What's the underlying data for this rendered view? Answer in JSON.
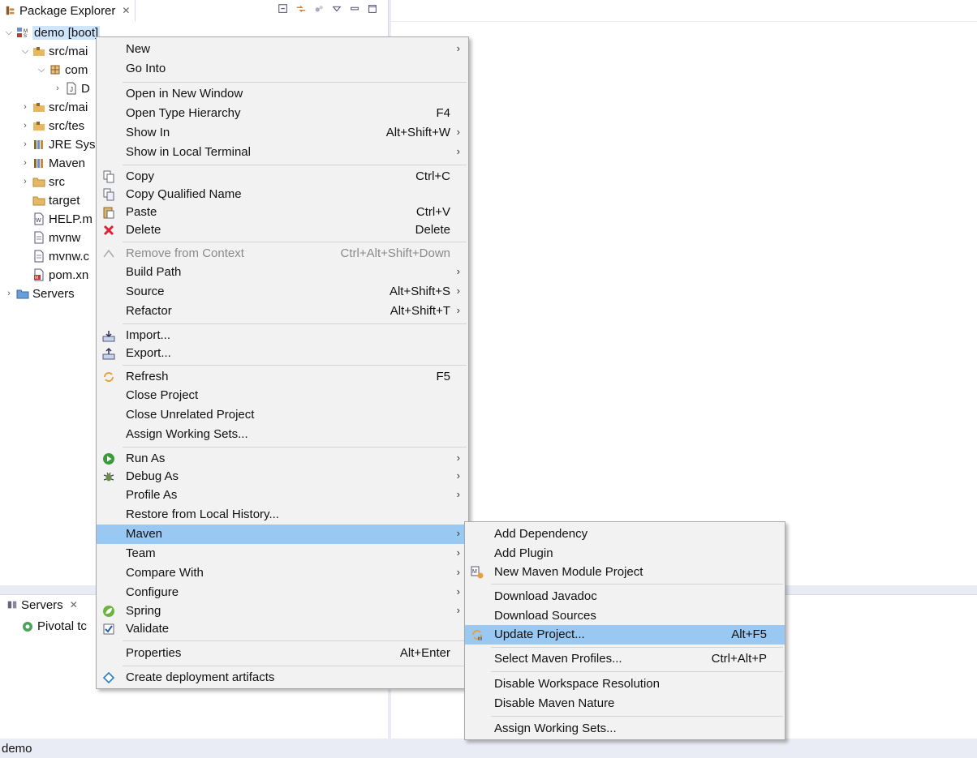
{
  "package_explorer": {
    "tab_title": "Package Explorer",
    "tree": [
      {
        "label": "demo [boot]",
        "icon": "maven-project-icon",
        "twisty": "expanded",
        "selected": true
      },
      {
        "label": "src/mai",
        "icon": "source-folder-icon",
        "twisty": "expanded"
      },
      {
        "label": "com",
        "icon": "package-icon",
        "twisty": "expanded"
      },
      {
        "label": "D",
        "icon": "java-file-icon",
        "twisty": "collapsed"
      },
      {
        "label": "src/mai",
        "icon": "source-folder-icon",
        "twisty": "collapsed"
      },
      {
        "label": "src/tes",
        "icon": "source-folder-icon",
        "twisty": "collapsed"
      },
      {
        "label": "JRE Sys",
        "icon": "library-icon",
        "twisty": "collapsed"
      },
      {
        "label": "Maven",
        "icon": "library-icon",
        "twisty": "collapsed"
      },
      {
        "label": "src",
        "icon": "folder-icon",
        "twisty": "collapsed"
      },
      {
        "label": "target",
        "icon": "folder-icon",
        "twisty": "none"
      },
      {
        "label": "HELP.m",
        "icon": "file-icon",
        "twisty": "none"
      },
      {
        "label": "mvnw",
        "icon": "file-icon",
        "twisty": "none"
      },
      {
        "label": "mvnw.c",
        "icon": "file-icon",
        "twisty": "none"
      },
      {
        "label": "pom.xn",
        "icon": "xml-file-icon",
        "twisty": "none"
      },
      {
        "label": "Servers",
        "icon": "folder-icon",
        "twisty": "collapsed"
      }
    ]
  },
  "servers_view": {
    "tab_title": "Servers",
    "item": "Pivotal tc"
  },
  "context_menu": {
    "items": [
      {
        "label": "New",
        "submenu": true
      },
      {
        "label": "Go Into"
      },
      {
        "label": "Open in New Window"
      },
      {
        "label": "Open Type Hierarchy",
        "shortcut": "F4"
      },
      {
        "label": "Show In",
        "shortcut": "Alt+Shift+W",
        "submenu": true
      },
      {
        "label": "Show in Local Terminal",
        "submenu": true
      },
      {
        "label": "Copy",
        "shortcut": "Ctrl+C",
        "icon": "copy-icon"
      },
      {
        "label": "Copy Qualified Name",
        "icon": "copy-qualified-icon"
      },
      {
        "label": "Paste",
        "shortcut": "Ctrl+V",
        "icon": "paste-icon"
      },
      {
        "label": "Delete",
        "shortcut": "Delete",
        "icon": "delete-icon"
      },
      {
        "label": "Remove from Context",
        "shortcut": "Ctrl+Alt+Shift+Down",
        "icon": "remove-context-icon",
        "disabled": true
      },
      {
        "label": "Build Path",
        "submenu": true
      },
      {
        "label": "Source",
        "shortcut": "Alt+Shift+S",
        "submenu": true
      },
      {
        "label": "Refactor",
        "shortcut": "Alt+Shift+T",
        "submenu": true
      },
      {
        "label": "Import...",
        "icon": "import-icon"
      },
      {
        "label": "Export...",
        "icon": "export-icon"
      },
      {
        "label": "Refresh",
        "shortcut": "F5",
        "icon": "refresh-icon"
      },
      {
        "label": "Close Project"
      },
      {
        "label": "Close Unrelated Project"
      },
      {
        "label": "Assign Working Sets..."
      },
      {
        "label": "Run As",
        "submenu": true,
        "icon": "run-icon"
      },
      {
        "label": "Debug As",
        "submenu": true,
        "icon": "debug-icon"
      },
      {
        "label": "Profile As",
        "submenu": true
      },
      {
        "label": "Restore from Local History..."
      },
      {
        "label": "Maven",
        "submenu": true,
        "highlighted": true
      },
      {
        "label": "Team",
        "submenu": true
      },
      {
        "label": "Compare With",
        "submenu": true
      },
      {
        "label": "Configure",
        "submenu": true
      },
      {
        "label": "Spring",
        "submenu": true,
        "icon": "spring-icon"
      },
      {
        "label": "Validate",
        "icon": "validate-check-icon"
      },
      {
        "label": "Properties",
        "shortcut": "Alt+Enter"
      },
      {
        "label": "Create deployment artifacts",
        "icon": "deployment-icon"
      }
    ]
  },
  "maven_submenu": {
    "items": [
      {
        "label": "Add Dependency"
      },
      {
        "label": "Add Plugin"
      },
      {
        "label": "New Maven Module Project",
        "icon": "maven-module-icon"
      },
      {
        "label": "Download Javadoc"
      },
      {
        "label": "Download Sources"
      },
      {
        "label": "Update Project...",
        "shortcut": "Alt+F5",
        "icon": "update-project-icon",
        "highlighted": true
      },
      {
        "label": "Select Maven Profiles...",
        "shortcut": "Ctrl+Alt+P"
      },
      {
        "label": "Disable Workspace Resolution"
      },
      {
        "label": "Disable Maven Nature"
      },
      {
        "label": "Assign Working Sets..."
      }
    ]
  },
  "status_bar": {
    "text": "demo"
  },
  "colors": {
    "highlight": "#99c9f2",
    "menu_bg": "#f2f2f2",
    "selection": "#cfe5fb"
  }
}
